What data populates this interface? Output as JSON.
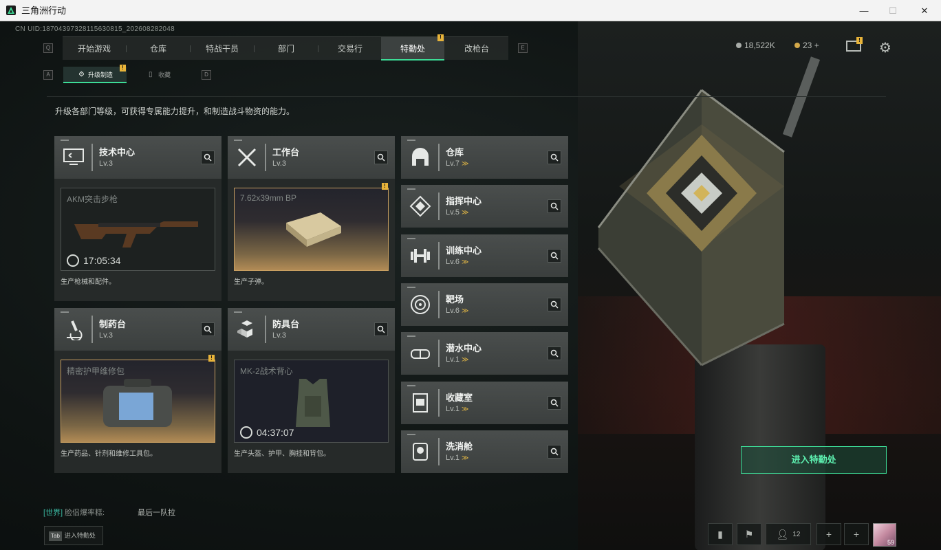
{
  "window": {
    "title": "三角洲行动",
    "minimize": "—",
    "maximize": "☐",
    "close": "✕"
  },
  "uid": "CN UID:18704397328115630815_202608282048",
  "nav": {
    "key_left": "Q",
    "key_right": "E",
    "tabs": [
      "开始游戏",
      "仓库",
      "特战干员",
      "部门",
      "交易行",
      "特勤处",
      "改枪台"
    ],
    "active": "特勤处",
    "badge": "!"
  },
  "subnav": {
    "key_left": "A",
    "key_right": "D",
    "tabs": [
      {
        "label": "升级制造",
        "active": true
      },
      {
        "label": "收藏",
        "active": false
      }
    ],
    "badge": "!"
  },
  "currency": {
    "silver": "18,522K",
    "gold": "23",
    "plus": "+",
    "mail_badge": "!"
  },
  "description": "升级各部门等级，可获得专属能力提升，和制造战斗物资的能力。",
  "production": [
    {
      "name": "技术中心",
      "level": "Lv.3",
      "item": "AKM突击步枪",
      "timer": "17:05:34",
      "desc": "生产枪械和配件。",
      "style": "normal",
      "badge": ""
    },
    {
      "name": "工作台",
      "level": "Lv.3",
      "item": "7.62x39mm BP",
      "timer": "",
      "desc": "生产子弹。",
      "style": "gold",
      "badge": "!"
    },
    {
      "name": "制药台",
      "level": "Lv.3",
      "item": "精密护甲维修包",
      "timer": "",
      "desc": "生产药品、针剂和维修工具包。",
      "style": "gold",
      "badge": "!"
    },
    {
      "name": "防具台",
      "level": "Lv.3",
      "item": "MK-2战术背心",
      "timer": "04:37:07",
      "desc": "生产头盔、护甲、胸挂和背包。",
      "style": "dark",
      "badge": ""
    }
  ],
  "departments": [
    {
      "name": "仓库",
      "level": "Lv.7"
    },
    {
      "name": "指挥中心",
      "level": "Lv.5"
    },
    {
      "name": "训练中心",
      "level": "Lv.6"
    },
    {
      "name": "靶场",
      "level": "Lv.6"
    },
    {
      "name": "潜水中心",
      "level": "Lv.1"
    },
    {
      "name": "收藏室",
      "level": "Lv.1"
    },
    {
      "name": "洗消舱",
      "level": "Lv.1"
    }
  ],
  "upgrade_glyph": "≫",
  "enter_button": "进入特勤处",
  "chat": {
    "channel": "[世界]",
    "sender": "脸侣爆率糕:",
    "message": "最后一队拉"
  },
  "tab_hint": {
    "key": "Tab",
    "label": "进入特勤处"
  },
  "bottom": {
    "friends_count": "12",
    "plus": "+",
    "avatar_level": "59"
  },
  "colors": {
    "accent": "#3ddc97",
    "badge": "#e8b43a",
    "gold": "#c9a062"
  }
}
